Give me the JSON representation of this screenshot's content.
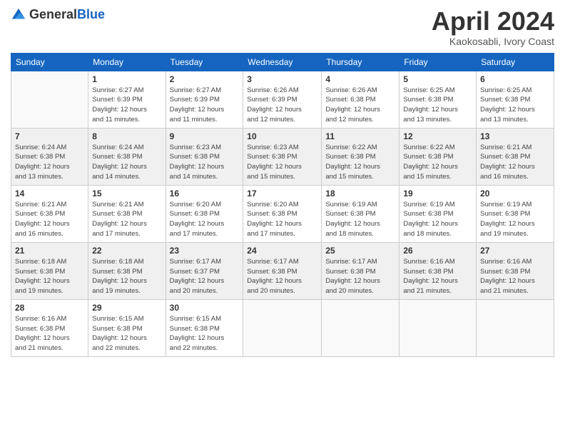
{
  "header": {
    "logo_general": "General",
    "logo_blue": "Blue",
    "month_title": "April 2024",
    "location": "Kaokosabli, Ivory Coast"
  },
  "days_of_week": [
    "Sunday",
    "Monday",
    "Tuesday",
    "Wednesday",
    "Thursday",
    "Friday",
    "Saturday"
  ],
  "weeks": [
    [
      {
        "day": "",
        "info": ""
      },
      {
        "day": "1",
        "info": "Sunrise: 6:27 AM\nSunset: 6:39 PM\nDaylight: 12 hours\nand 11 minutes."
      },
      {
        "day": "2",
        "info": "Sunrise: 6:27 AM\nSunset: 6:39 PM\nDaylight: 12 hours\nand 11 minutes."
      },
      {
        "day": "3",
        "info": "Sunrise: 6:26 AM\nSunset: 6:39 PM\nDaylight: 12 hours\nand 12 minutes."
      },
      {
        "day": "4",
        "info": "Sunrise: 6:26 AM\nSunset: 6:38 PM\nDaylight: 12 hours\nand 12 minutes."
      },
      {
        "day": "5",
        "info": "Sunrise: 6:25 AM\nSunset: 6:38 PM\nDaylight: 12 hours\nand 13 minutes."
      },
      {
        "day": "6",
        "info": "Sunrise: 6:25 AM\nSunset: 6:38 PM\nDaylight: 12 hours\nand 13 minutes."
      }
    ],
    [
      {
        "day": "7",
        "info": "Sunrise: 6:24 AM\nSunset: 6:38 PM\nDaylight: 12 hours\nand 13 minutes."
      },
      {
        "day": "8",
        "info": "Sunrise: 6:24 AM\nSunset: 6:38 PM\nDaylight: 12 hours\nand 14 minutes."
      },
      {
        "day": "9",
        "info": "Sunrise: 6:23 AM\nSunset: 6:38 PM\nDaylight: 12 hours\nand 14 minutes."
      },
      {
        "day": "10",
        "info": "Sunrise: 6:23 AM\nSunset: 6:38 PM\nDaylight: 12 hours\nand 15 minutes."
      },
      {
        "day": "11",
        "info": "Sunrise: 6:22 AM\nSunset: 6:38 PM\nDaylight: 12 hours\nand 15 minutes."
      },
      {
        "day": "12",
        "info": "Sunrise: 6:22 AM\nSunset: 6:38 PM\nDaylight: 12 hours\nand 15 minutes."
      },
      {
        "day": "13",
        "info": "Sunrise: 6:21 AM\nSunset: 6:38 PM\nDaylight: 12 hours\nand 16 minutes."
      }
    ],
    [
      {
        "day": "14",
        "info": "Sunrise: 6:21 AM\nSunset: 6:38 PM\nDaylight: 12 hours\nand 16 minutes."
      },
      {
        "day": "15",
        "info": "Sunrise: 6:21 AM\nSunset: 6:38 PM\nDaylight: 12 hours\nand 17 minutes."
      },
      {
        "day": "16",
        "info": "Sunrise: 6:20 AM\nSunset: 6:38 PM\nDaylight: 12 hours\nand 17 minutes."
      },
      {
        "day": "17",
        "info": "Sunrise: 6:20 AM\nSunset: 6:38 PM\nDaylight: 12 hours\nand 17 minutes."
      },
      {
        "day": "18",
        "info": "Sunrise: 6:19 AM\nSunset: 6:38 PM\nDaylight: 12 hours\nand 18 minutes."
      },
      {
        "day": "19",
        "info": "Sunrise: 6:19 AM\nSunset: 6:38 PM\nDaylight: 12 hours\nand 18 minutes."
      },
      {
        "day": "20",
        "info": "Sunrise: 6:19 AM\nSunset: 6:38 PM\nDaylight: 12 hours\nand 19 minutes."
      }
    ],
    [
      {
        "day": "21",
        "info": "Sunrise: 6:18 AM\nSunset: 6:38 PM\nDaylight: 12 hours\nand 19 minutes."
      },
      {
        "day": "22",
        "info": "Sunrise: 6:18 AM\nSunset: 6:38 PM\nDaylight: 12 hours\nand 19 minutes."
      },
      {
        "day": "23",
        "info": "Sunrise: 6:17 AM\nSunset: 6:37 PM\nDaylight: 12 hours\nand 20 minutes."
      },
      {
        "day": "24",
        "info": "Sunrise: 6:17 AM\nSunset: 6:38 PM\nDaylight: 12 hours\nand 20 minutes."
      },
      {
        "day": "25",
        "info": "Sunrise: 6:17 AM\nSunset: 6:38 PM\nDaylight: 12 hours\nand 20 minutes."
      },
      {
        "day": "26",
        "info": "Sunrise: 6:16 AM\nSunset: 6:38 PM\nDaylight: 12 hours\nand 21 minutes."
      },
      {
        "day": "27",
        "info": "Sunrise: 6:16 AM\nSunset: 6:38 PM\nDaylight: 12 hours\nand 21 minutes."
      }
    ],
    [
      {
        "day": "28",
        "info": "Sunrise: 6:16 AM\nSunset: 6:38 PM\nDaylight: 12 hours\nand 21 minutes."
      },
      {
        "day": "29",
        "info": "Sunrise: 6:15 AM\nSunset: 6:38 PM\nDaylight: 12 hours\nand 22 minutes."
      },
      {
        "day": "30",
        "info": "Sunrise: 6:15 AM\nSunset: 6:38 PM\nDaylight: 12 hours\nand 22 minutes."
      },
      {
        "day": "",
        "info": ""
      },
      {
        "day": "",
        "info": ""
      },
      {
        "day": "",
        "info": ""
      },
      {
        "day": "",
        "info": ""
      }
    ]
  ]
}
